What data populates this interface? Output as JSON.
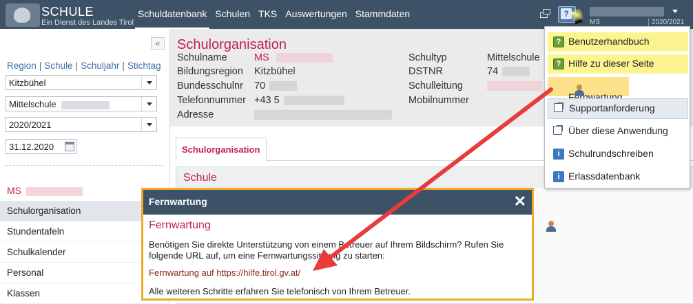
{
  "app": {
    "logo_title": "SCHULE",
    "logo_subtitle": "Ein Dienst des Landes Tirol",
    "nav": [
      "Schuldatenbank",
      "Schulen",
      "TKS",
      "Auswertungen",
      "Stammdaten"
    ],
    "school_short": "MS",
    "school_year": "2020/2021"
  },
  "sidebar": {
    "filter_links": [
      "Region",
      "Schule",
      "Schuljahr",
      "Stichtag"
    ],
    "region_value": "Kitzbühel",
    "school_value": "Mittelschule",
    "year_value": "2020/2021",
    "date_value": "31.12.2020",
    "school_name": "MS",
    "menu": [
      "Schulorganisation",
      "Stundentafeln",
      "Schulkalender",
      "Personal",
      "Klassen"
    ]
  },
  "header": {
    "title": "Schulorganisation",
    "labels_left": [
      "Schulname",
      "Bildungsregion",
      "Bundesschulnr",
      "Telefonnummer",
      "Adresse"
    ],
    "values_left": [
      "MS",
      "Kitzbühel",
      "70",
      "+43 5",
      ""
    ],
    "labels_right": [
      "Schultyp",
      "DSTNR",
      "Schulleitung",
      "Mobilnummer"
    ],
    "values_right": [
      "Mittelschule",
      "74",
      "",
      ""
    ]
  },
  "tabs": {
    "active": "Schulorganisation"
  },
  "section": {
    "title": "Schule"
  },
  "help_menu": {
    "items": [
      "Benutzerhandbuch",
      "Hilfe zu dieser Seite",
      "Fernwartung",
      "Supportanforderung",
      "Über diese Anwendung",
      "Schulrundschreiben",
      "Erlassdatenbank"
    ]
  },
  "popup": {
    "header": "Fernwartung",
    "close": "✕",
    "title": "Fernwartung",
    "text": "Benötigen Sie direkte Unterstützung von einem Betreuer auf Ihrem Bildschirm? Rufen Sie folgende URL auf, um eine Fernwartungssitzung zu starten:",
    "link": "Fernwartung auf https://hilfe.tirol.gv.at/",
    "footer": "Alle weiteren Schritte erfahren Sie telefonisch von Ihrem Betreuer."
  },
  "colors": {
    "topbar": "#3d5266",
    "accent_red": "#c0224a",
    "highlight_yellow": "#fcf491",
    "highlight_orange": "#fde08a",
    "popup_border": "#f0a928",
    "arrow": "#e83c3c"
  }
}
